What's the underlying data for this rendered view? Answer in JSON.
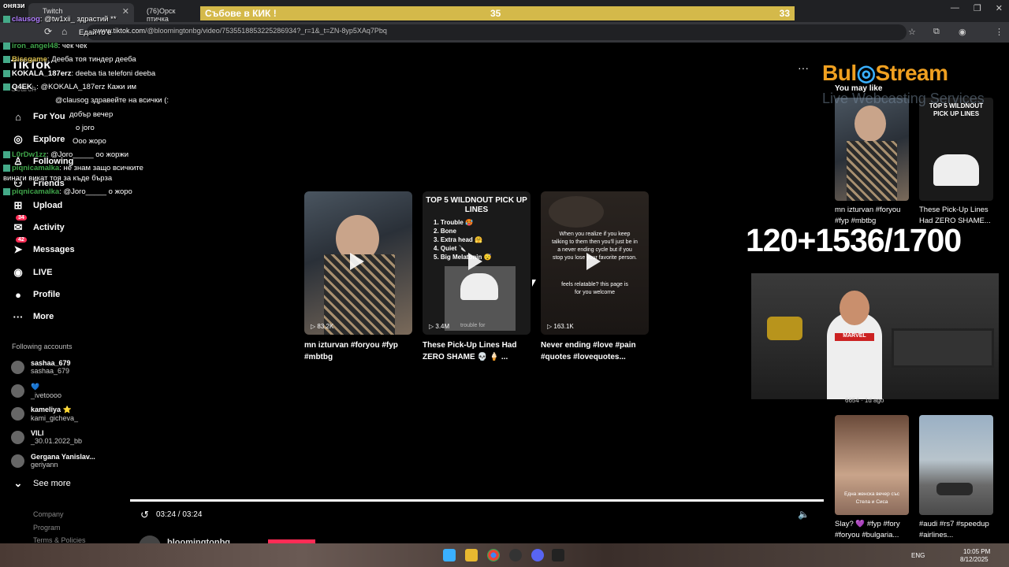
{
  "browser": {
    "tabs": [
      {
        "label": "Twitch",
        "active": true
      },
      {
        "label": "(76)Орск птичка",
        "active": false
      }
    ],
    "url_host": "www.tiktok.com",
    "url_path": "/@bloomingtonbg/video/7535518853225286934?_r=1&_t=ZN-8yp5XAq7Pbq",
    "window_controls": [
      "—",
      "❐",
      "✕"
    ]
  },
  "overlay_bar": {
    "label": "Събове в КИК !",
    "num1": "35",
    "num2": "33"
  },
  "tiktok": {
    "logo": "TikTok",
    "search_placeholder": "Search",
    "nav": [
      {
        "label": "For You",
        "icon": "home-icon"
      },
      {
        "label": "Explore",
        "icon": "compass-icon"
      },
      {
        "label": "Following",
        "icon": "following-icon"
      },
      {
        "label": "Friends",
        "icon": "friends-icon"
      },
      {
        "label": "Upload",
        "icon": "upload-icon"
      },
      {
        "label": "Activity",
        "icon": "activity-icon",
        "badge": "34"
      },
      {
        "label": "Messages",
        "icon": "messages-icon",
        "badge": "42"
      },
      {
        "label": "LIVE",
        "icon": "live-icon"
      },
      {
        "label": "Profile",
        "icon": "profile-icon"
      },
      {
        "label": "More",
        "icon": "more-icon"
      }
    ],
    "following_title": "Following accounts",
    "accounts": [
      {
        "name": "sashaa_679",
        "handle": "sashaa_679"
      },
      {
        "name": "💙",
        "handle": "_ivetoooo"
      },
      {
        "name": "kameliya ⭐",
        "handle": "kami_gicheva_"
      },
      {
        "name": "VILI",
        "handle": "_30.01.2022_bb"
      },
      {
        "name": "Gergana Yanislav...",
        "handle": "geriyann"
      }
    ],
    "see_more": "See more",
    "footer_links": [
      "Company",
      "Program",
      "Terms & Policies"
    ],
    "recommendations": [
      {
        "title": "mn izturvan #foryou #fyp #mbtbg",
        "views": "83.2K"
      },
      {
        "title": "These Pick-Up Lines Had ZERO SHAME 💀 🍦 ...",
        "views": "3.4M",
        "overlay_title": "TOP 5 WILDNOUT PICK UP LINES",
        "list": [
          "1. Trouble 🥵",
          "2. Bone",
          "3. Extra head 🤗",
          "4. Quiet 🔪",
          "5. Big Melatonin 😴"
        ],
        "caption": "trouble for"
      },
      {
        "title": "Never ending #love #pain #quotes #lovequotes...",
        "views": "163.1K",
        "overlay_text": "When you realize if you keep talking to them then you'll just be in a never ending cycle but if you stop you lose your favorite person.",
        "overlay_text2": "feels relatable? this page is for you welcome"
      }
    ],
    "player": {
      "time": "03:24 / 03:24",
      "author": "bloomingtonbg"
    },
    "right": {
      "heading": "You may like",
      "items": [
        {
          "title": "mn izturvan #foryou #fyp #mbtbg"
        },
        {
          "title": "These Pick-Up Lines Had ZERO SHAME..."
        },
        {
          "title": "Slay? 💜 #fyp #fory #foryou #bulgaria..."
        },
        {
          "title": "#audi #rs7 #speedup #airlines..."
        }
      ],
      "thumb2_overlay": "TOP 5 WILDNOUT PICK UP LINES",
      "thumb3_caption": "Една женска вечер със Стела и Сиса",
      "time_ago": "6654 · 1d ago"
    }
  },
  "chat": [
    {
      "user": "онязи",
      "msg": "",
      "color": "#fff"
    },
    {
      "user": "clausog",
      "msg": "@tw1xii_ здрастий **",
      "color": "#b07cff"
    },
    {
      "user": "",
      "msg": "Едай го е",
      "color": "#fff"
    },
    {
      "user": "iron_angel48",
      "msg": "чек чек",
      "color": "#3fa54a"
    },
    {
      "user": "Bissgame",
      "msg": "Дееба тоя тиндер дееба",
      "color": "#d4b94a"
    },
    {
      "user": "KOKALA_187erz",
      "msg": "deeba tia telefoni deeba",
      "color": "#fff"
    },
    {
      "user": "Q4EK_",
      "msg": "@KOKALA_187erz Кажи им",
      "color": "#fff"
    },
    {
      "user": "",
      "msg": "@clausog здравейте на всички (:",
      "color": "#5a7bff"
    },
    {
      "user": "",
      "msg": "добър вечер",
      "color": "#fff"
    },
    {
      "user": "",
      "msg": "о joro",
      "color": "#5a7bff"
    },
    {
      "user": "",
      "msg": "Ооо жоро",
      "color": "#5a7bff"
    },
    {
      "user": "L0rDw1zz",
      "msg": "@Joro_____ оо жоржи",
      "color": "#3fa54a"
    },
    {
      "user": "piqnicamalka",
      "msg": "не знам защо всичките",
      "color": "#3fa54a"
    },
    {
      "user": "",
      "msg": "винаги викат тоя за къде бърза",
      "color": "#fff"
    },
    {
      "user": "piqnicamalka",
      "msg": "@Joro_____ о жоро",
      "color": "#3fa54a"
    }
  ],
  "stream": {
    "logo_a": "Bul",
    "logo_b": "Stream",
    "logo_sub": "Live Webcasting Services",
    "counter": "120+1536/1700",
    "webcam_shirt": "MARVEL"
  },
  "taskbar": {
    "lang": "ENG",
    "time": "10:05 PM",
    "date": "8/12/2025"
  }
}
